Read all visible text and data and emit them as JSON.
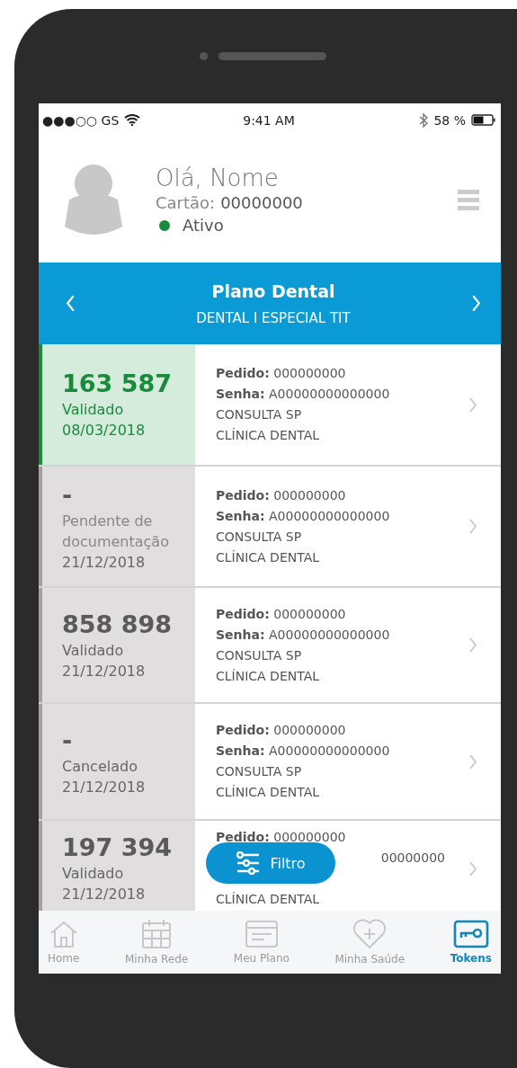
{
  "status_bar": {
    "carrier": "●●●○○ GS",
    "time": "9:41 AM",
    "battery": "58 %"
  },
  "header": {
    "greeting": "Olá, Nome",
    "card_label": "Cartão:",
    "card_number": "00000000",
    "status": "Ativo",
    "active": true
  },
  "plan": {
    "title": "Plano Dental",
    "subtitle": "DENTAL I ESPECIAL TIT"
  },
  "tokens": [
    {
      "code": "163 587",
      "status": "Validado",
      "date": "08/03/2018",
      "kind": "validated",
      "selected": true,
      "pedido_label": "Pedido:",
      "pedido": "000000000",
      "senha_label": "Senha:",
      "senha": "A00000000000000",
      "service": "CONSULTA SP",
      "provider": "CLÍNICA DENTAL"
    },
    {
      "code": "-",
      "status": "Pendente de documentação",
      "date": "21/12/2018",
      "kind": "pending",
      "selected": false,
      "pedido_label": "Pedido:",
      "pedido": "000000000",
      "senha_label": "Senha:",
      "senha": "A00000000000000",
      "service": "CONSULTA SP",
      "provider": "CLÍNICA DENTAL"
    },
    {
      "code": "858 898",
      "status": "Validado",
      "date": "21/12/2018",
      "kind": "validated",
      "selected": false,
      "pedido_label": "Pedido:",
      "pedido": "000000000",
      "senha_label": "Senha:",
      "senha": "A00000000000000",
      "service": "CONSULTA SP",
      "provider": "CLÍNICA DENTAL"
    },
    {
      "code": "-",
      "status": "Cancelado",
      "date": "21/12/2018",
      "kind": "cancelled",
      "selected": false,
      "pedido_label": "Pedido:",
      "pedido": "000000000",
      "senha_label": "Senha:",
      "senha": "A00000000000000",
      "service": "CONSULTA SP",
      "provider": "CLÍNICA DENTAL"
    },
    {
      "code": "197 394",
      "status": "Validado",
      "date": "21/12/2018",
      "kind": "validated",
      "selected": false,
      "pedido_label": "Pedido:",
      "pedido": "000000000",
      "senha": "00000000",
      "provider": "CLÍNICA DENTAL"
    }
  ],
  "filter_button": "Filtro",
  "tabs": [
    {
      "label": "Home",
      "selected": false
    },
    {
      "label": "Minha Rede",
      "selected": false
    },
    {
      "label": "Meu Plano",
      "selected": false
    },
    {
      "label": "Minha Saúde",
      "selected": false
    },
    {
      "label": "Tokens",
      "selected": true
    }
  ]
}
